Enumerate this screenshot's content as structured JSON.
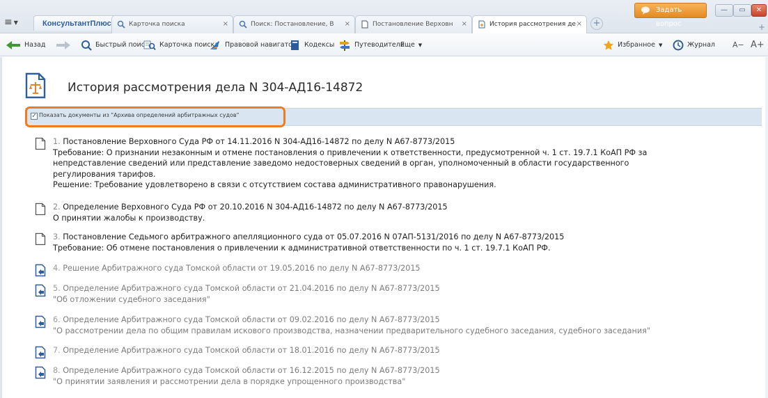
{
  "app": {
    "brand": "КонсультантПлюс",
    "ask_button": "Задать вопрос"
  },
  "tabs": [
    {
      "label": "Карточка поиска",
      "active": false
    },
    {
      "label": "Поиск: Постановление, В",
      "active": false
    },
    {
      "label": "Постановление Верховн",
      "active": false
    },
    {
      "label": "История рассмотрения де",
      "active": true
    }
  ],
  "toolbar": {
    "back": "Назад",
    "quick_search": "Быстрый поиск",
    "search_card": "Карточка поиска",
    "legal_navigator": "Правовой навигатор",
    "codes": "Кодексы",
    "guides": "Путеводители",
    "more": "Еще",
    "favorites": "Избранное",
    "journal": "Журнал",
    "font_smaller": "A−",
    "font_larger": "A+"
  },
  "page": {
    "title": "История рассмотрения дела N 304-АД16-14872",
    "archive_checkbox_label": "Показать документы из \"Архива определений арбитражных судов\"",
    "archive_checkbox_checked": true
  },
  "documents": [
    {
      "num": "1.",
      "title": "Постановление Верховного Суда РФ от 14.11.2016 N 304-АД16-14872 по делу N А67-8773/2015",
      "lines": [
        "Требование: О признании незаконным и отмене постановления о привлечении к ответственности, предусмотренной ч. 1 ст. 19.7.1 КоАП РФ за",
        "непредставление сведений или представление заведомо недостоверных сведений в орган, уполномоченный в области государственного",
        "регулирования тарифов.",
        "Решение: Требование удовлетворено в связи с отсутствием состава административного правонарушения."
      ],
      "source": "active"
    },
    {
      "num": "2.",
      "title": "Определение Верховного Суда РФ от 20.10.2016 N 304-АД16-14872 по делу N А67-8773/2015",
      "lines": [
        "О принятии жалобы к производству."
      ],
      "source": "active"
    },
    {
      "num": "3.",
      "title": "Постановление Седьмого арбитражного апелляционного суда от 05.07.2016 N 07АП-5131/2016 по делу N А67-8773/2015",
      "lines": [
        "Требование: Об отмене постановления о привлечении к административной ответственности по ч. 1 ст. 19.7.1 КоАП РФ."
      ],
      "source": "active"
    },
    {
      "num": "4.",
      "title": "Решение Арбитражного суда Томской области от 19.05.2016 по делу N А67-8773/2015",
      "lines": [],
      "source": "archive"
    },
    {
      "num": "5.",
      "title": "Определение Арбитражного суда Томской области от 21.04.2016 по делу N А67-8773/2015",
      "lines": [
        "\"Об отложении судебного заседания\""
      ],
      "source": "archive"
    },
    {
      "num": "6.",
      "title": "Определение Арбитражного суда Томской области от 09.02.2016 по делу N А67-8773/2015",
      "lines": [
        "\"О рассмотрении дела по общим правилам искового производства, назначении предварительного судебного заседания, судебного заседания\""
      ],
      "source": "archive"
    },
    {
      "num": "7.",
      "title": "Определение Арбитражного суда Томской области от 18.01.2016 по делу N А67-8773/2015",
      "lines": [],
      "source": "archive"
    },
    {
      "num": "8.",
      "title": "Определение Арбитражного суда Томской области от 16.12.2015 по делу N А67-8773/2015",
      "lines": [
        "\"О принятии заявления и рассмотрении дела в порядке упрощенного производства\""
      ],
      "source": "archive"
    }
  ],
  "colors": {
    "highlight_frame": "#ee7d22",
    "archive_bar": "#d9e6f1",
    "brand": "#2b5fa5"
  }
}
